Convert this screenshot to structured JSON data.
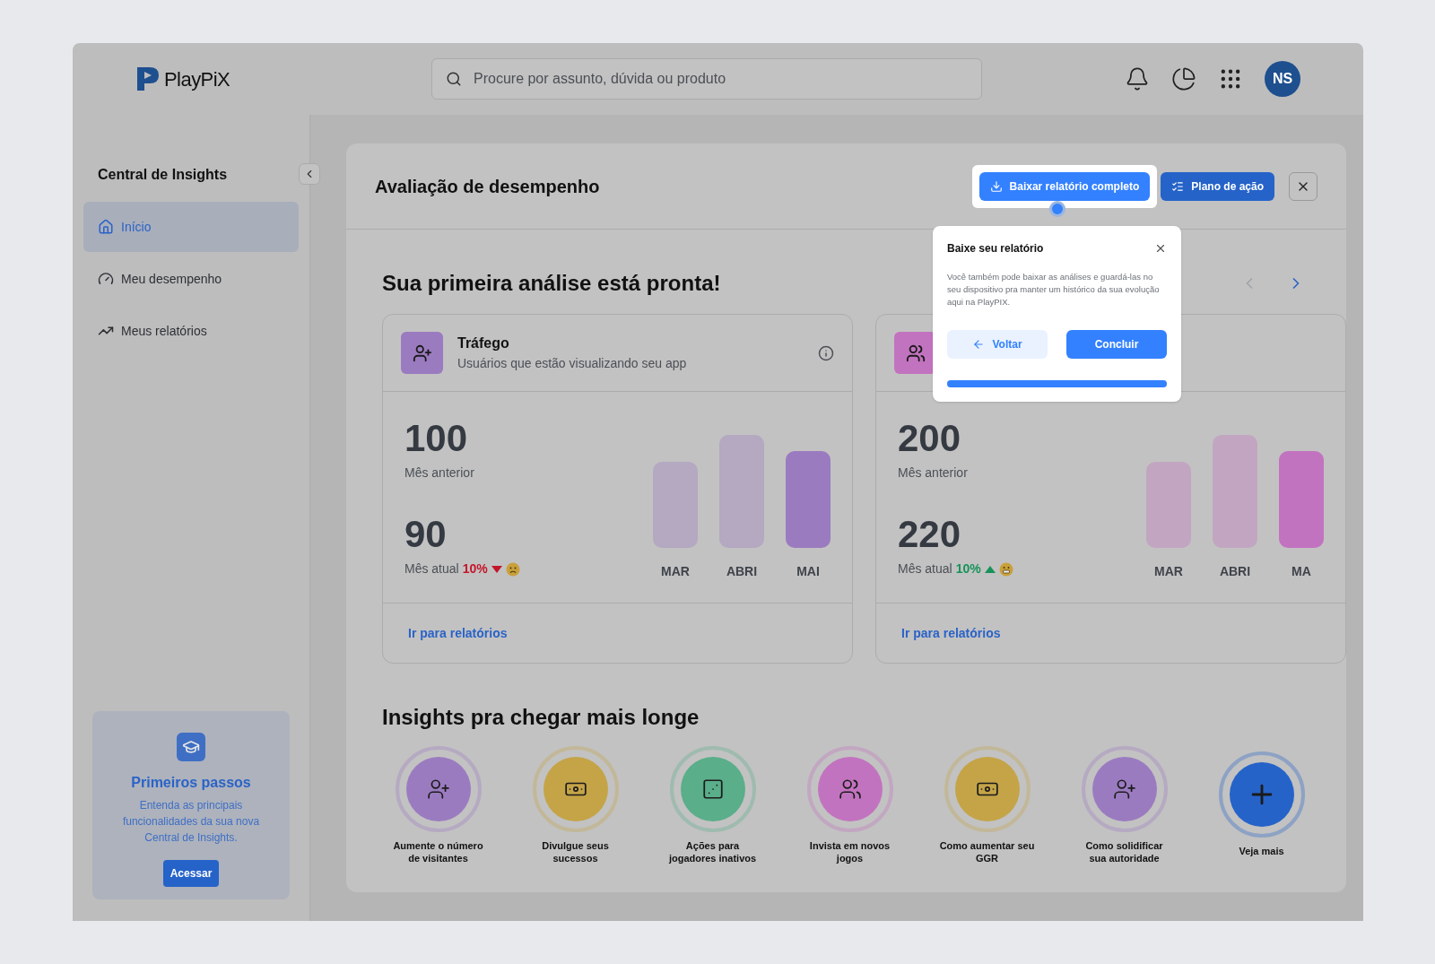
{
  "header": {
    "logo": "PlayPiX",
    "search": {
      "placeholder": "Procure por assunto, dúvida ou produto"
    },
    "avatar": "NS"
  },
  "sidebar": {
    "title": "Central de Insights",
    "items": [
      {
        "label": "Início",
        "kind": "home",
        "selected": true
      },
      {
        "label": "Meu desempenho",
        "kind": "gauge",
        "selected": false
      },
      {
        "label": "Meus relatórios",
        "kind": "trend",
        "selected": false
      }
    ],
    "promo": {
      "title": "Primeiros passos",
      "text": "Entenda as principais funcionalidades da sua nova Central de Insights.",
      "button": "Acessar"
    }
  },
  "page": {
    "title": "Avaliação de desempenho",
    "actions": [
      {
        "label": "Baixar relatório completo",
        "kind": "download",
        "highlighted": true
      },
      {
        "label": "Plano de ação",
        "kind": "plan",
        "highlighted": false
      }
    ]
  },
  "section_title": "Sua primeira análise está pronta!",
  "carousel_arrows": [
    {
      "kind": "prev",
      "disabled": true
    },
    {
      "kind": "next",
      "disabled": false
    }
  ],
  "metric_cards": [
    {
      "kind": "user-plus",
      "color": "#9b7bc0",
      "title": "Tráfego",
      "subtitle": "Usuários que estão visualizando seu app",
      "previous": "100",
      "previous_label": "Mês anterior",
      "current": "90",
      "current_label": "Mês atual",
      "change": "10%",
      "increase": false,
      "months": [
        {
          "label": "MAR",
          "highlighted": false
        },
        {
          "label": "ABRI",
          "highlighted": false
        },
        {
          "label": "MAI",
          "highlighted": true
        }
      ],
      "link": "Ir para relatórios"
    },
    {
      "kind": "users",
      "color": "#c273bf",
      "previous": "200",
      "previous_label": "Mês anterior",
      "current": "220",
      "current_label": "Mês atual",
      "change": "10%",
      "increase": true,
      "months": [
        {
          "label": "MAR",
          "highlighted": false
        },
        {
          "label": "ABRI",
          "highlighted": false
        },
        {
          "label": "MA",
          "highlighted": true
        }
      ],
      "link": "Ir para relatórios"
    }
  ],
  "insights": {
    "title": "Insights pra chegar mais longe",
    "items": [
      {
        "label": "Aumente o número de visitantes",
        "kind": "user-plus",
        "color": "#9b7bc0"
      },
      {
        "label": "Divulgue seus sucessos",
        "kind": "money",
        "color": "#c4a447"
      },
      {
        "label": "Ações para jogadores inativos",
        "kind": "dice",
        "color": "#5aae8a"
      },
      {
        "label": "Invista em novos jogos",
        "kind": "users",
        "color": "#c273bf"
      },
      {
        "label": "Como aumentar seu GGR",
        "kind": "money",
        "color": "#c4a447"
      },
      {
        "label": "Como solidificar sua autoridade",
        "kind": "user-plus",
        "color": "#9b7bc0"
      },
      {
        "label": "Veja mais",
        "kind": "plus",
        "color": "#2563c9"
      }
    ]
  },
  "popover": {
    "title": "Baixe seu relatório",
    "text": "Você também pode baixar as análises e guardá-las no seu dispositivo pra manter um histórico da sua evolução aqui na PlayPIX.",
    "back": "Voltar",
    "done": "Concluir",
    "level": 1
  }
}
